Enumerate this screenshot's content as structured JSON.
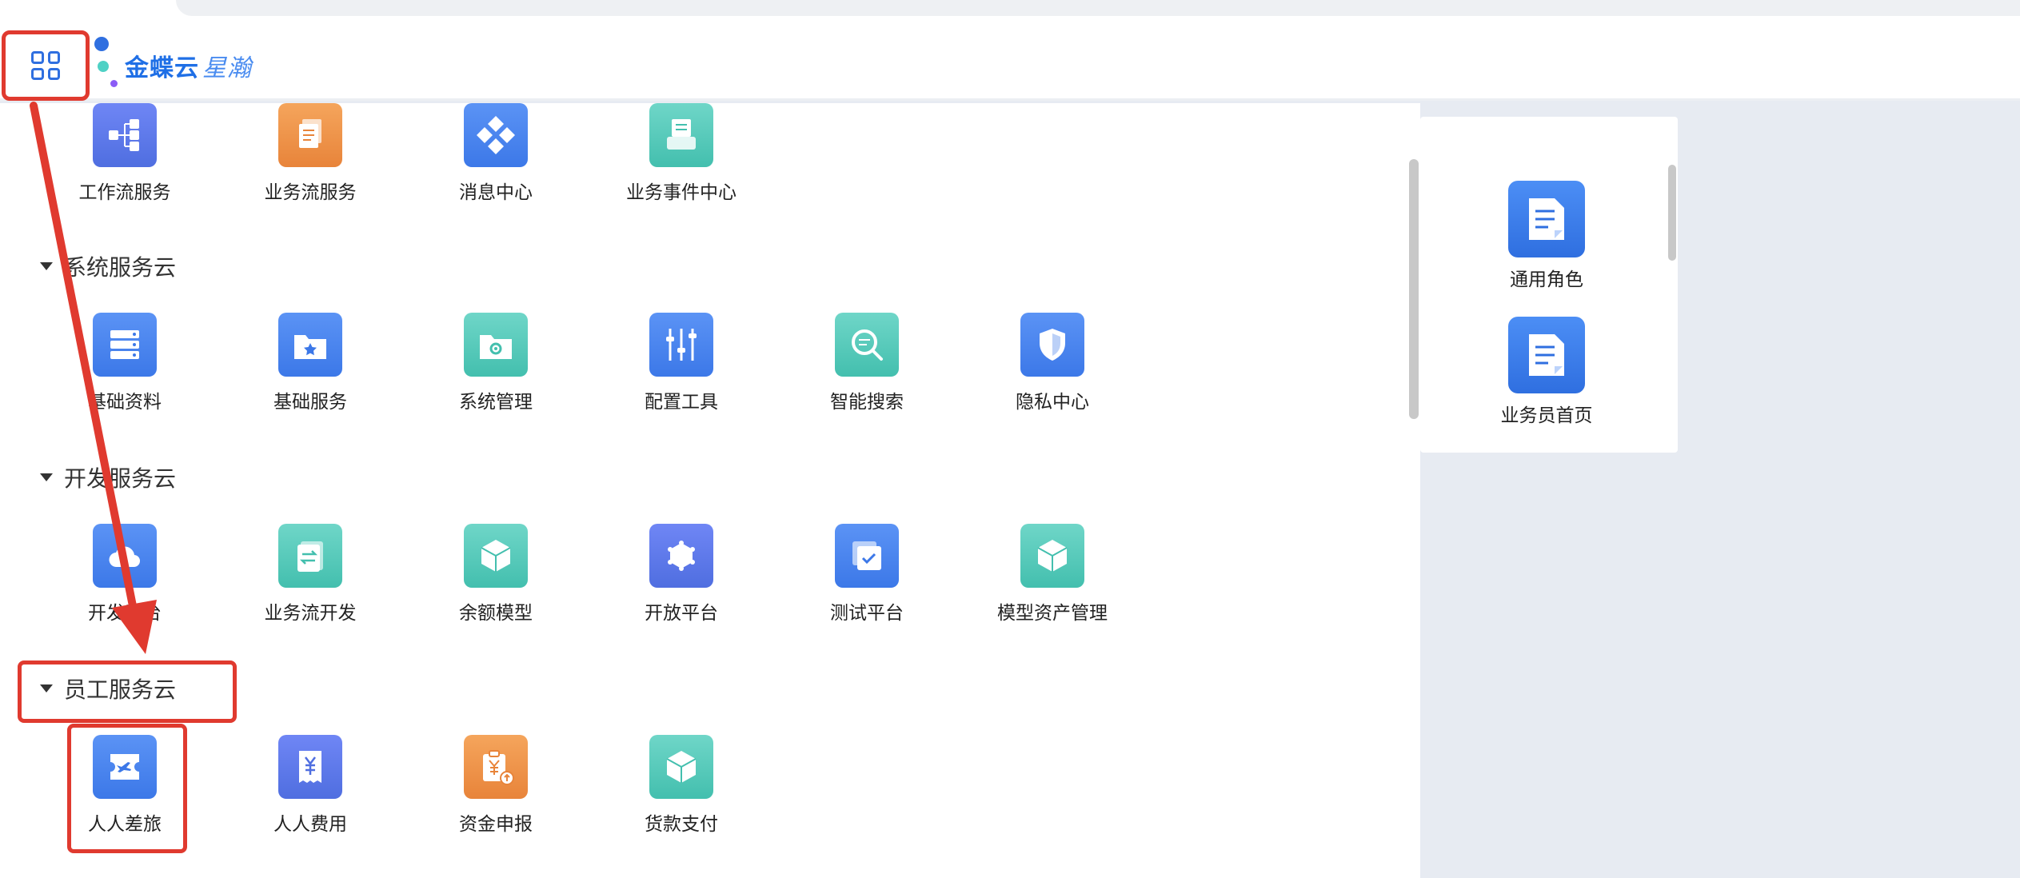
{
  "header": {
    "logo_text": "金蝶云",
    "logo_sub": "星瀚"
  },
  "sections": {
    "workflow_row": {
      "items": [
        {
          "label": "工作流服务",
          "icon": "workflow-icon"
        },
        {
          "label": "业务流服务",
          "icon": "document-stack-icon"
        },
        {
          "label": "消息中心",
          "icon": "diamond-grid-icon"
        },
        {
          "label": "业务事件中心",
          "icon": "printer-icon"
        }
      ]
    },
    "system_cloud": {
      "title": "系统服务云",
      "items": [
        {
          "label": "基础资料",
          "icon": "server-icon"
        },
        {
          "label": "基础服务",
          "icon": "star-folder-icon"
        },
        {
          "label": "系统管理",
          "icon": "gear-folder-icon"
        },
        {
          "label": "配置工具",
          "icon": "sliders-icon"
        },
        {
          "label": "智能搜索",
          "icon": "search-icon"
        },
        {
          "label": "隐私中心",
          "icon": "shield-icon"
        }
      ]
    },
    "dev_cloud": {
      "title": "开发服务云",
      "items": [
        {
          "label": "开发平台",
          "icon": "cloud-icon"
        },
        {
          "label": "业务流开发",
          "icon": "swap-document-icon"
        },
        {
          "label": "余额模型",
          "icon": "cube-icon"
        },
        {
          "label": "开放平台",
          "icon": "hexagon-network-icon"
        },
        {
          "label": "测试平台",
          "icon": "check-window-icon"
        },
        {
          "label": "模型资产管理",
          "icon": "cube-icon"
        }
      ]
    },
    "employee_cloud": {
      "title": "员工服务云",
      "items": [
        {
          "label": "人人差旅",
          "icon": "plane-ticket-icon"
        },
        {
          "label": "人人费用",
          "icon": "yen-receipt-icon"
        },
        {
          "label": "资金申报",
          "icon": "yen-clipboard-icon"
        },
        {
          "label": "货款支付",
          "icon": "cube-icon"
        }
      ]
    }
  },
  "right_card": {
    "items": [
      {
        "label": "通用角色",
        "icon": "document-icon"
      },
      {
        "label": "业务员首页",
        "icon": "document-icon"
      }
    ]
  },
  "colors": {
    "annotation_red": "#e03a2f",
    "brand_blue": "#1f6fe6"
  }
}
